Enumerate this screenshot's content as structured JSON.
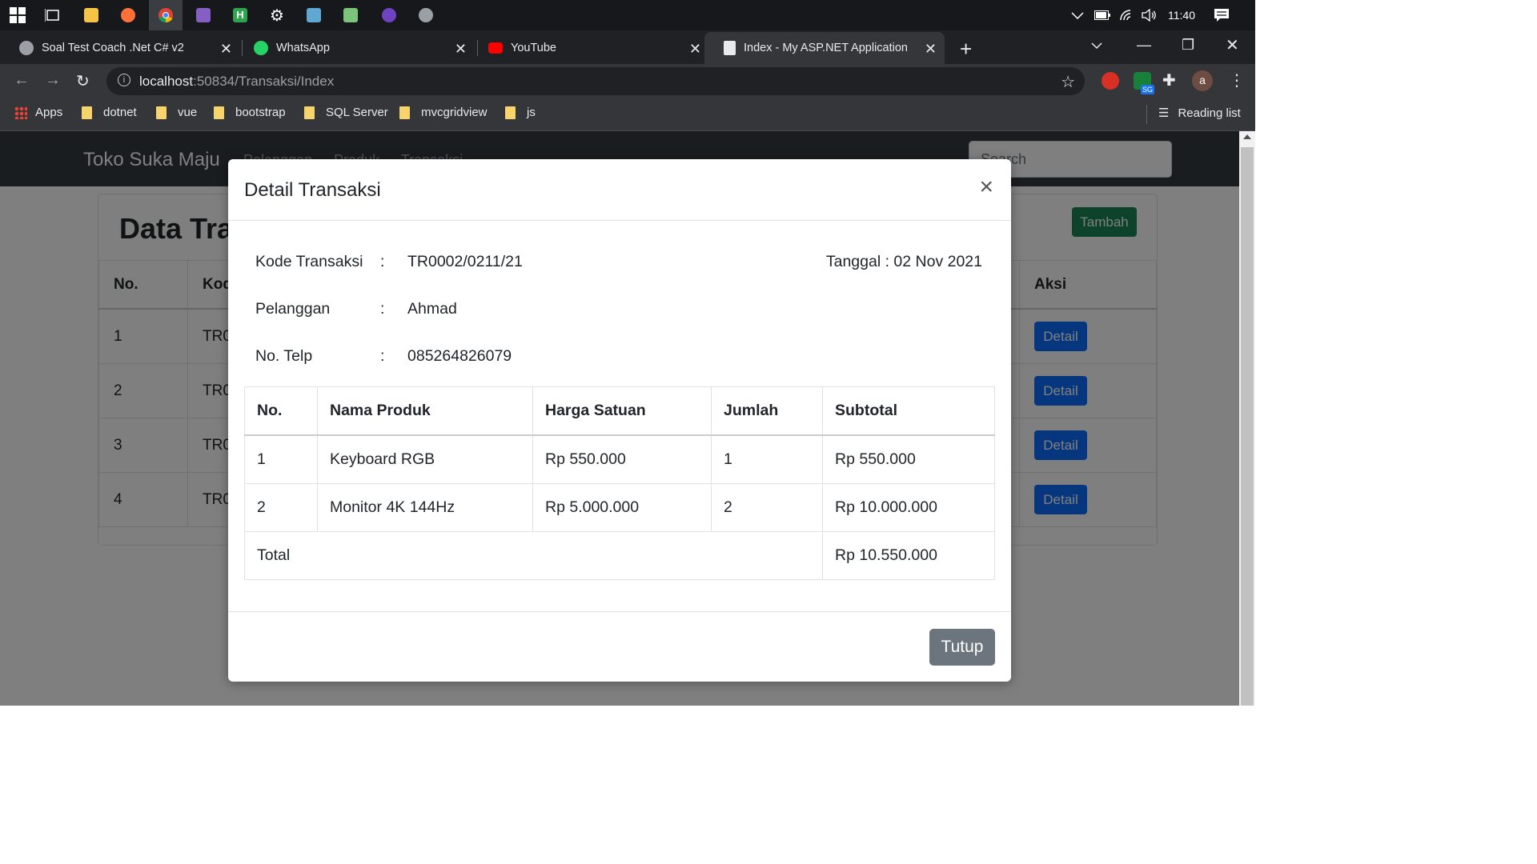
{
  "taskbar": {
    "time": "11:40",
    "icons": [
      "windows-start-icon",
      "task-view-icon",
      "file-explorer-icon",
      "firefox-icon",
      "chrome-icon",
      "visual-studio-icon",
      "h-app-icon",
      "settings-gear-icon",
      "tool-icon",
      "notepad-icon",
      "github-icon",
      "app-icon"
    ]
  },
  "browser": {
    "tabs": [
      {
        "title": "Soal Test Coach .Net C# v2",
        "icon": "globe-icon"
      },
      {
        "title": "WhatsApp",
        "icon": "whatsapp-icon"
      },
      {
        "title": "YouTube",
        "icon": "youtube-icon"
      },
      {
        "title": "Index - My ASP.NET Application",
        "icon": "page-icon"
      }
    ],
    "url_host": "localhost",
    "url_rest": ":50834/Transaksi/Index",
    "profile_initial": "a",
    "extension_badge": "SG",
    "bookmarks": [
      "Apps",
      "dotnet",
      "vue",
      "bootstrap",
      "SQL Server",
      "mvcgridview",
      "js"
    ],
    "reading_list": "Reading list"
  },
  "page": {
    "brand": "Toko Suka Maju",
    "nav": [
      "Pelanggan",
      "Produk",
      "Transaksi"
    ],
    "search_placeholder": "Search",
    "card_title": "Data Transaksi",
    "add_button": "Tambah",
    "table": {
      "headers": [
        "No.",
        "Kode",
        "Aksi"
      ],
      "rows": [
        {
          "no": "1",
          "kode": "TR0"
        },
        {
          "no": "2",
          "kode": "TR0"
        },
        {
          "no": "3",
          "kode": "TR0"
        },
        {
          "no": "4",
          "kode": "TR0"
        }
      ],
      "action_label": "Detail"
    }
  },
  "modal": {
    "title": "Detail Transaksi",
    "close": "×",
    "fields": {
      "kode_label": "Kode Transaksi",
      "kode_value": "TR0002/0211/21",
      "pelanggan_label": "Pelanggan",
      "pelanggan_value": "Ahmad",
      "telp_label": "No. Telp",
      "telp_value": "085264826079",
      "colon": ":",
      "tanggal": "Tanggal : 02 Nov 2021"
    },
    "table": {
      "headers": [
        "No.",
        "Nama Produk",
        "Harga Satuan",
        "Jumlah",
        "Subtotal"
      ],
      "rows": [
        {
          "no": "1",
          "nama": "Keyboard RGB",
          "harga": "Rp 550.000",
          "jumlah": "1",
          "subtotal": "Rp 550.000"
        },
        {
          "no": "2",
          "nama": "Monitor 4K 144Hz",
          "harga": "Rp 5.000.000",
          "jumlah": "2",
          "subtotal": "Rp 10.000.000"
        }
      ],
      "total_label": "Total",
      "total_value": "Rp 10.550.000"
    },
    "close_button": "Tutup"
  },
  "colors": {
    "success": "#198754",
    "primary": "#0d6efd",
    "secondary": "#6c757d",
    "navbar": "#343a40"
  }
}
